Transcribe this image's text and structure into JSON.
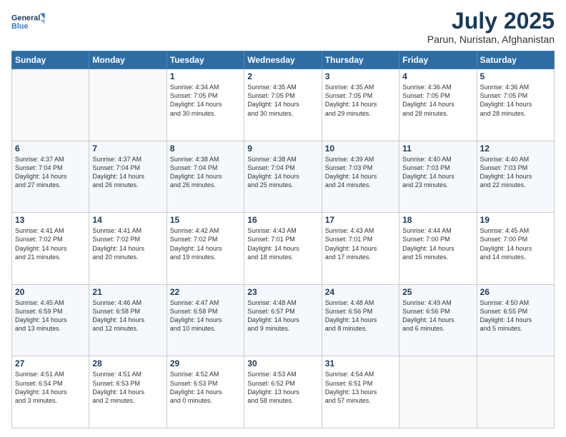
{
  "header": {
    "logo_line1": "General",
    "logo_line2": "Blue",
    "month": "July 2025",
    "location": "Parun, Nuristan, Afghanistan"
  },
  "weekdays": [
    "Sunday",
    "Monday",
    "Tuesday",
    "Wednesday",
    "Thursday",
    "Friday",
    "Saturday"
  ],
  "weeks": [
    [
      {
        "day": "",
        "info": ""
      },
      {
        "day": "",
        "info": ""
      },
      {
        "day": "1",
        "info": "Sunrise: 4:34 AM\nSunset: 7:05 PM\nDaylight: 14 hours\nand 30 minutes."
      },
      {
        "day": "2",
        "info": "Sunrise: 4:35 AM\nSunset: 7:05 PM\nDaylight: 14 hours\nand 30 minutes."
      },
      {
        "day": "3",
        "info": "Sunrise: 4:35 AM\nSunset: 7:05 PM\nDaylight: 14 hours\nand 29 minutes."
      },
      {
        "day": "4",
        "info": "Sunrise: 4:36 AM\nSunset: 7:05 PM\nDaylight: 14 hours\nand 28 minutes."
      },
      {
        "day": "5",
        "info": "Sunrise: 4:36 AM\nSunset: 7:05 PM\nDaylight: 14 hours\nand 28 minutes."
      }
    ],
    [
      {
        "day": "6",
        "info": "Sunrise: 4:37 AM\nSunset: 7:04 PM\nDaylight: 14 hours\nand 27 minutes."
      },
      {
        "day": "7",
        "info": "Sunrise: 4:37 AM\nSunset: 7:04 PM\nDaylight: 14 hours\nand 26 minutes."
      },
      {
        "day": "8",
        "info": "Sunrise: 4:38 AM\nSunset: 7:04 PM\nDaylight: 14 hours\nand 26 minutes."
      },
      {
        "day": "9",
        "info": "Sunrise: 4:38 AM\nSunset: 7:04 PM\nDaylight: 14 hours\nand 25 minutes."
      },
      {
        "day": "10",
        "info": "Sunrise: 4:39 AM\nSunset: 7:03 PM\nDaylight: 14 hours\nand 24 minutes."
      },
      {
        "day": "11",
        "info": "Sunrise: 4:40 AM\nSunset: 7:03 PM\nDaylight: 14 hours\nand 23 minutes."
      },
      {
        "day": "12",
        "info": "Sunrise: 4:40 AM\nSunset: 7:03 PM\nDaylight: 14 hours\nand 22 minutes."
      }
    ],
    [
      {
        "day": "13",
        "info": "Sunrise: 4:41 AM\nSunset: 7:02 PM\nDaylight: 14 hours\nand 21 minutes."
      },
      {
        "day": "14",
        "info": "Sunrise: 4:41 AM\nSunset: 7:02 PM\nDaylight: 14 hours\nand 20 minutes."
      },
      {
        "day": "15",
        "info": "Sunrise: 4:42 AM\nSunset: 7:02 PM\nDaylight: 14 hours\nand 19 minutes."
      },
      {
        "day": "16",
        "info": "Sunrise: 4:43 AM\nSunset: 7:01 PM\nDaylight: 14 hours\nand 18 minutes."
      },
      {
        "day": "17",
        "info": "Sunrise: 4:43 AM\nSunset: 7:01 PM\nDaylight: 14 hours\nand 17 minutes."
      },
      {
        "day": "18",
        "info": "Sunrise: 4:44 AM\nSunset: 7:00 PM\nDaylight: 14 hours\nand 15 minutes."
      },
      {
        "day": "19",
        "info": "Sunrise: 4:45 AM\nSunset: 7:00 PM\nDaylight: 14 hours\nand 14 minutes."
      }
    ],
    [
      {
        "day": "20",
        "info": "Sunrise: 4:45 AM\nSunset: 6:59 PM\nDaylight: 14 hours\nand 13 minutes."
      },
      {
        "day": "21",
        "info": "Sunrise: 4:46 AM\nSunset: 6:58 PM\nDaylight: 14 hours\nand 12 minutes."
      },
      {
        "day": "22",
        "info": "Sunrise: 4:47 AM\nSunset: 6:58 PM\nDaylight: 14 hours\nand 10 minutes."
      },
      {
        "day": "23",
        "info": "Sunrise: 4:48 AM\nSunset: 6:57 PM\nDaylight: 14 hours\nand 9 minutes."
      },
      {
        "day": "24",
        "info": "Sunrise: 4:48 AM\nSunset: 6:56 PM\nDaylight: 14 hours\nand 8 minutes."
      },
      {
        "day": "25",
        "info": "Sunrise: 4:49 AM\nSunset: 6:56 PM\nDaylight: 14 hours\nand 6 minutes."
      },
      {
        "day": "26",
        "info": "Sunrise: 4:50 AM\nSunset: 6:55 PM\nDaylight: 14 hours\nand 5 minutes."
      }
    ],
    [
      {
        "day": "27",
        "info": "Sunrise: 4:51 AM\nSunset: 6:54 PM\nDaylight: 14 hours\nand 3 minutes."
      },
      {
        "day": "28",
        "info": "Sunrise: 4:51 AM\nSunset: 6:53 PM\nDaylight: 14 hours\nand 2 minutes."
      },
      {
        "day": "29",
        "info": "Sunrise: 4:52 AM\nSunset: 6:53 PM\nDaylight: 14 hours\nand 0 minutes."
      },
      {
        "day": "30",
        "info": "Sunrise: 4:53 AM\nSunset: 6:52 PM\nDaylight: 13 hours\nand 58 minutes."
      },
      {
        "day": "31",
        "info": "Sunrise: 4:54 AM\nSunset: 6:51 PM\nDaylight: 13 hours\nand 57 minutes."
      },
      {
        "day": "",
        "info": ""
      },
      {
        "day": "",
        "info": ""
      }
    ]
  ]
}
